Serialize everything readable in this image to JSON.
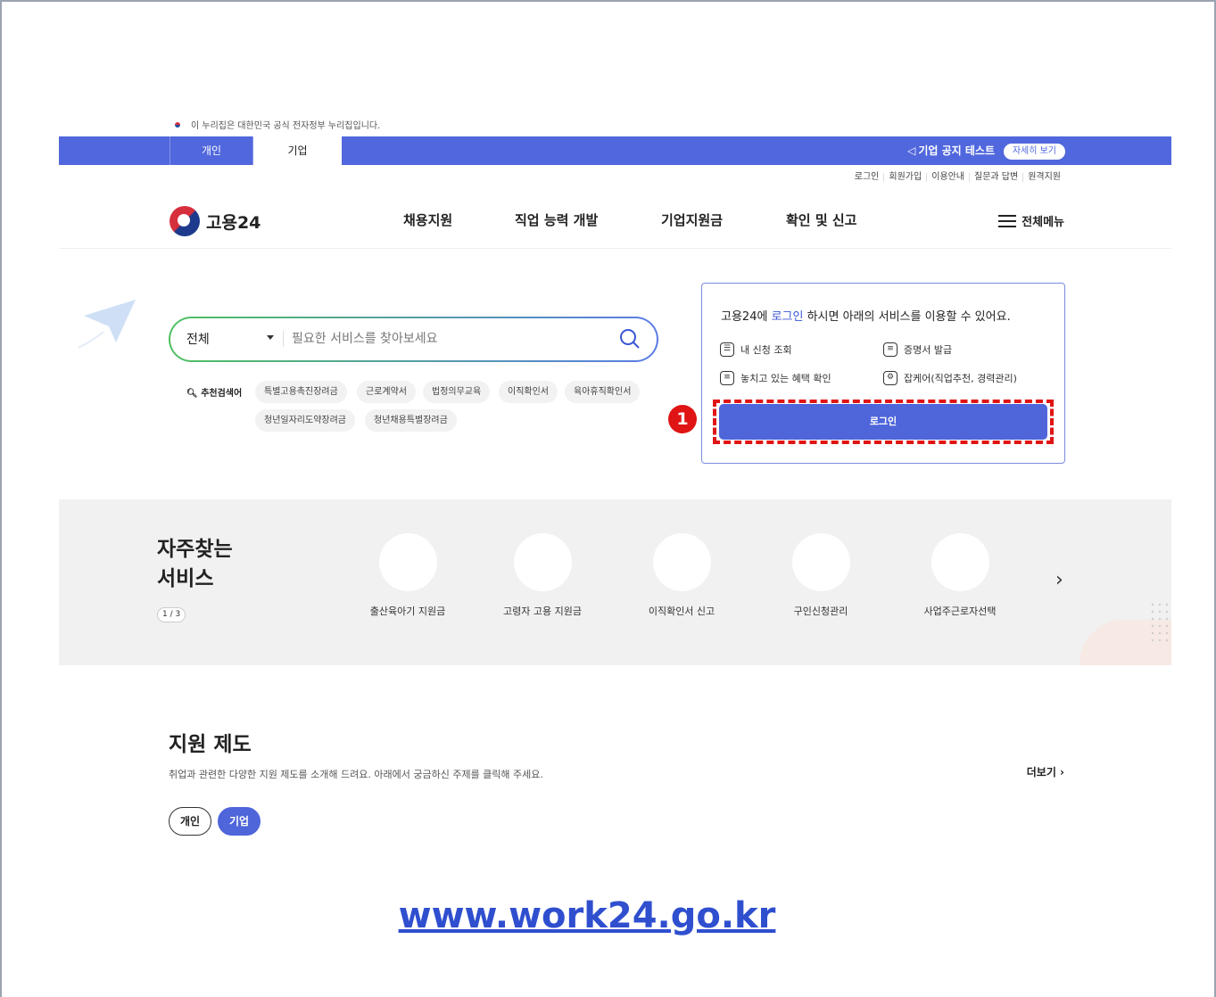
{
  "gov_notice": "이 누리집은 대한민국 공식 전자정부 누리집입니다.",
  "user_tabs": [
    "개인",
    "기업"
  ],
  "notice": {
    "text": "기업 공지 테스트",
    "button": "자세히 보기"
  },
  "util_links": [
    "로그인",
    "회원가입",
    "이용안내",
    "질문과 답변",
    "원격지원"
  ],
  "logo_text": "고용24",
  "gnb": [
    "채용지원",
    "직업 능력 개발",
    "기업지원금",
    "확인 및 신고"
  ],
  "all_menu": "전체메뉴",
  "search": {
    "scope": "전체",
    "placeholder": "필요한 서비스를 찾아보세요",
    "recommend_label": "추천검색어",
    "keywords": [
      "특별고용촉진장려금",
      "근로계약서",
      "법정의무교육",
      "이직확인서",
      "육아휴직확인서",
      "청년일자리도약장려금",
      "청년채용특별장려금"
    ]
  },
  "login_box": {
    "title_pre": "고용24에 ",
    "title_link": "로그인",
    "title_post": " 하시면 아래의 서비스를 이용할 수 있어요.",
    "services": [
      "내 신청 조회",
      "증명서 발급",
      "놓치고 있는 혜택 확인",
      "잡케어(직업추천, 경력관리)"
    ],
    "button": "로그인"
  },
  "callout_number": "1",
  "frequent": {
    "title": "자주찾는 서비스",
    "pager": "1 / 3",
    "items": [
      "출산육아기 지원금",
      "고령자 고용 지원금",
      "이직확인서 신고",
      "구인신청관리",
      "사업주근로자선택"
    ]
  },
  "support": {
    "title": "지원 제도",
    "desc": "취업과 관련한 다양한 지원 제도를 소개해 드려요. 아래에서 궁금하신 주제를 클릭해 주세요.",
    "more": "더보기",
    "filters": [
      "개인",
      "기업"
    ]
  },
  "site_url": "www.work24.go.kr"
}
